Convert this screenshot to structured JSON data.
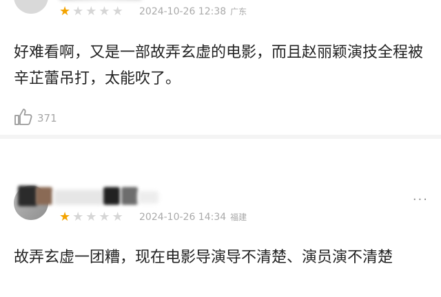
{
  "reviews": [
    {
      "rating": 1,
      "max_rating": 5,
      "date": "2024-10-26 12:38",
      "location": "广东",
      "content": "好难看啊，又是一部故弄玄虚的电影，而且赵丽颖演技全程被辛芷蕾吊打，太能吹了。",
      "likes": "371",
      "more_icon": "more-dots-icon",
      "like_icon": "thumbs-up-icon"
    },
    {
      "rating": 1,
      "max_rating": 5,
      "date": "2024-10-26 14:34",
      "location": "福建",
      "content": "故弄玄虚一团糟，现在电影导演导不清楚、演员演不清楚",
      "more_icon": "more-dots-icon"
    }
  ],
  "colors": {
    "star_filled": "#f3a300",
    "star_empty": "#d6d6d6",
    "meta_text": "#a9a9a9",
    "divider": "#f4f4f4"
  }
}
